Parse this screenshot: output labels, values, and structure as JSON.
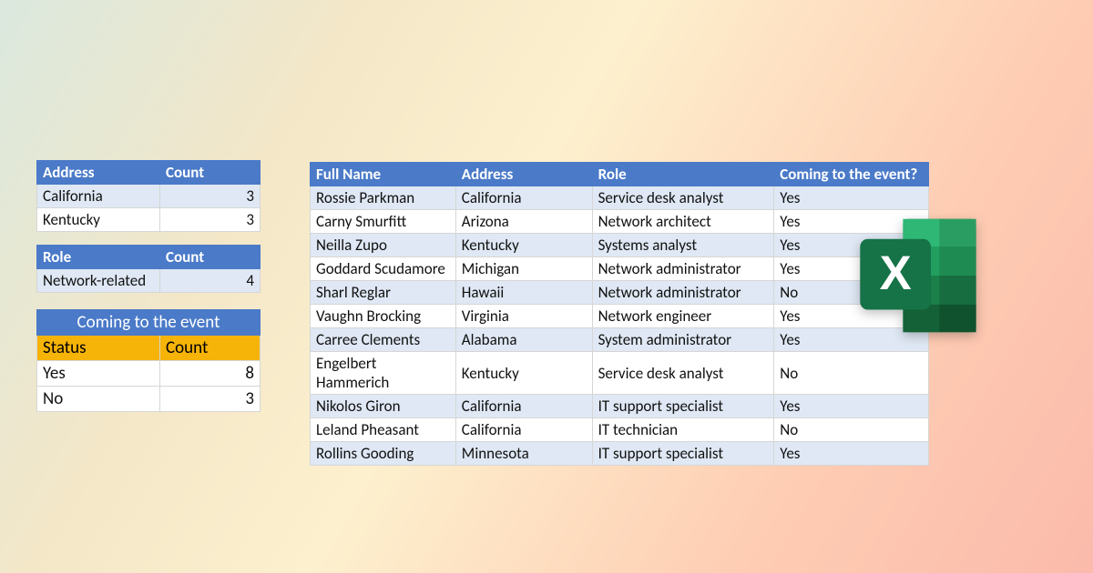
{
  "summary": {
    "address_table": {
      "headers": [
        "Address",
        "Count"
      ],
      "rows": [
        {
          "label": "California",
          "count": 3
        },
        {
          "label": "Kentucky",
          "count": 3
        }
      ]
    },
    "role_table": {
      "headers": [
        "Role",
        "Count"
      ],
      "rows": [
        {
          "label": "Network-related",
          "count": 4
        }
      ]
    },
    "event_table": {
      "title": "Coming to the event",
      "headers": [
        "Status",
        "Count"
      ],
      "rows": [
        {
          "label": "Yes",
          "count": 8
        },
        {
          "label": "No",
          "count": 3
        }
      ]
    }
  },
  "main": {
    "headers": [
      "Full Name",
      "Address",
      "Role",
      "Coming to the event?"
    ],
    "rows": [
      {
        "name": "Rossie Parkman",
        "address": "California",
        "role": "Service desk analyst",
        "coming": "Yes"
      },
      {
        "name": "Carny Smurfitt",
        "address": "Arizona",
        "role": "Network architect",
        "coming": "Yes"
      },
      {
        "name": "Neilla Zupo",
        "address": "Kentucky",
        "role": "Systems analyst",
        "coming": "Yes"
      },
      {
        "name": "Goddard Scudamore",
        "address": "Michigan",
        "role": "Network administrator",
        "coming": "Yes"
      },
      {
        "name": "Sharl Reglar",
        "address": "Hawaii",
        "role": "Network administrator",
        "coming": "No"
      },
      {
        "name": "Vaughn Brocking",
        "address": "Virginia",
        "role": "Network engineer",
        "coming": "Yes"
      },
      {
        "name": "Carree Clements",
        "address": "Alabama",
        "role": "System administrator",
        "coming": "Yes"
      },
      {
        "name": "Engelbert Hammerich",
        "address": "Kentucky",
        "role": "Service desk analyst",
        "coming": "No"
      },
      {
        "name": "Nikolos Giron",
        "address": "California",
        "role": "IT support specialist",
        "coming": "Yes"
      },
      {
        "name": "Leland Pheasant",
        "address": "California",
        "role": "IT technician",
        "coming": "No"
      },
      {
        "name": "Rollins Gooding",
        "address": "Minnesota",
        "role": "IT support specialist",
        "coming": "Yes"
      }
    ]
  }
}
